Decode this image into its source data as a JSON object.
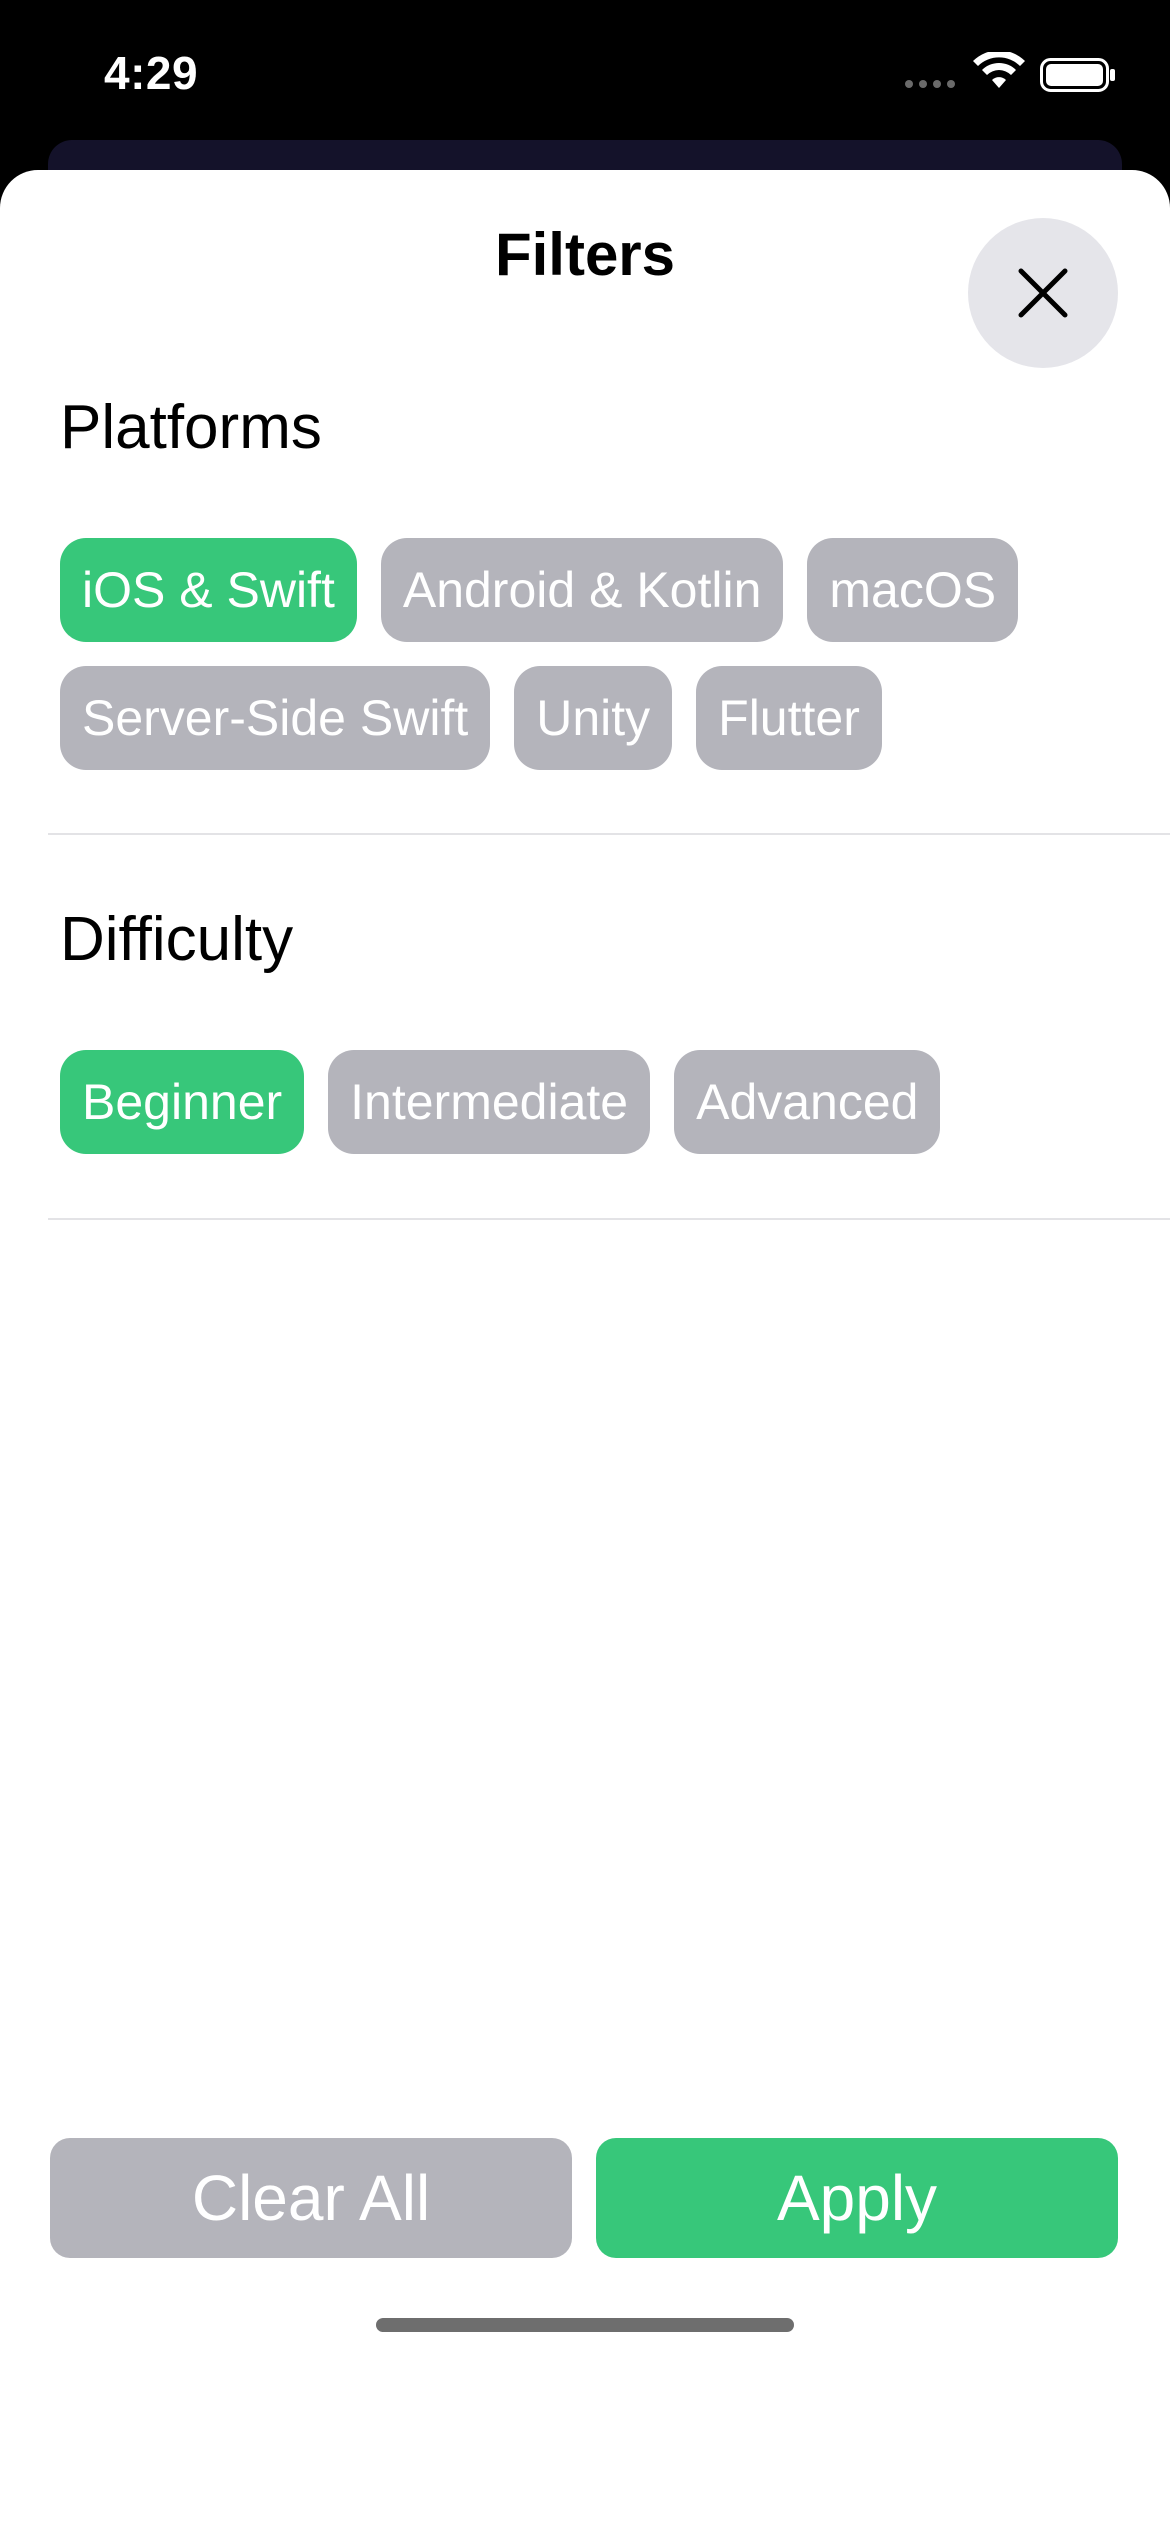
{
  "status_bar": {
    "time": "4:29",
    "icons": [
      "cellular-signal-icon",
      "wifi-icon",
      "battery-icon"
    ]
  },
  "sheet": {
    "title": "Filters",
    "close_icon": "close-icon"
  },
  "platforms": {
    "heading": "Platforms",
    "options": [
      {
        "label": "iOS & Swift",
        "selected": true
      },
      {
        "label": "Android & Kotlin",
        "selected": false
      },
      {
        "label": "macOS",
        "selected": false
      },
      {
        "label": "Server-Side Swift",
        "selected": false
      },
      {
        "label": "Unity",
        "selected": false
      },
      {
        "label": "Flutter",
        "selected": false
      }
    ]
  },
  "difficulty": {
    "heading": "Difficulty",
    "options": [
      {
        "label": "Beginner",
        "selected": true
      },
      {
        "label": "Intermediate",
        "selected": false
      },
      {
        "label": "Advanced",
        "selected": false
      }
    ]
  },
  "footer": {
    "clear_label": "Clear All",
    "apply_label": "Apply"
  },
  "colors": {
    "selected": "#37c77a",
    "unselected": "#b4b4bb",
    "close_bg": "#e5e5ea"
  }
}
